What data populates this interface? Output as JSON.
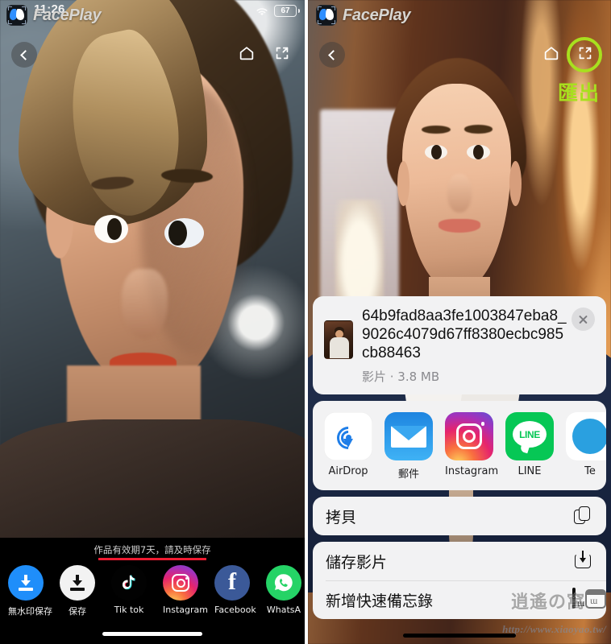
{
  "left_phone": {
    "status_bar": {
      "time": "11:26",
      "battery": "67",
      "wifi_icon": "wifi-icon"
    },
    "brand": {
      "name": "FacePlay",
      "logo_icon": "faceplay-logo-icon"
    },
    "nav": {
      "back_icon": "chevron-left-icon",
      "home_icon": "home-icon",
      "share_icon": "share-export-icon"
    },
    "notice": "作品有效期7天，請及時保存",
    "share_targets": [
      {
        "label": "無水印保存",
        "icon": "download-no-watermark-icon"
      },
      {
        "label": "保存",
        "icon": "download-icon"
      },
      {
        "label": "Tik tok",
        "icon": "tiktok-icon"
      },
      {
        "label": "Instagram",
        "icon": "instagram-icon"
      },
      {
        "label": "Facebook",
        "icon": "facebook-icon"
      },
      {
        "label": "WhatsA",
        "icon": "whatsapp-icon"
      }
    ]
  },
  "right_phone": {
    "brand": {
      "name": "FacePlay",
      "logo_icon": "faceplay-logo-icon"
    },
    "nav": {
      "back_icon": "chevron-left-icon",
      "home_icon": "home-icon",
      "share_icon": "share-export-icon"
    },
    "annotation": {
      "label": "匯出",
      "color": "#a8e01e"
    },
    "share_sheet": {
      "file_name": "64b9fad8aa3fe1003847eba8_9026c4079d67ff8380ecbc985cb88463",
      "file_meta": "影片 · 3.8 MB",
      "close_icon": "close-icon",
      "thumbnail_icon": "video-thumbnail",
      "apps": [
        {
          "label": "AirDrop",
          "icon": "airdrop-icon"
        },
        {
          "label": "郵件",
          "icon": "mail-icon"
        },
        {
          "label": "Instagram",
          "icon": "instagram-icon"
        },
        {
          "label": "LINE",
          "icon": "line-icon",
          "badge_text": "LINE"
        },
        {
          "label": "Te",
          "icon": "telegram-icon"
        }
      ],
      "actions_group_1": [
        {
          "label": "拷貝",
          "icon": "copy-icon"
        }
      ],
      "actions_group_2": [
        {
          "label": "儲存影片",
          "icon": "save-video-icon"
        },
        {
          "label": "新增快速備忘錄",
          "icon": "quick-note-icon"
        }
      ]
    },
    "watermark": {
      "site_cn": "逍遙の窩",
      "url": "http://www.xiaoyao.tw/"
    }
  }
}
